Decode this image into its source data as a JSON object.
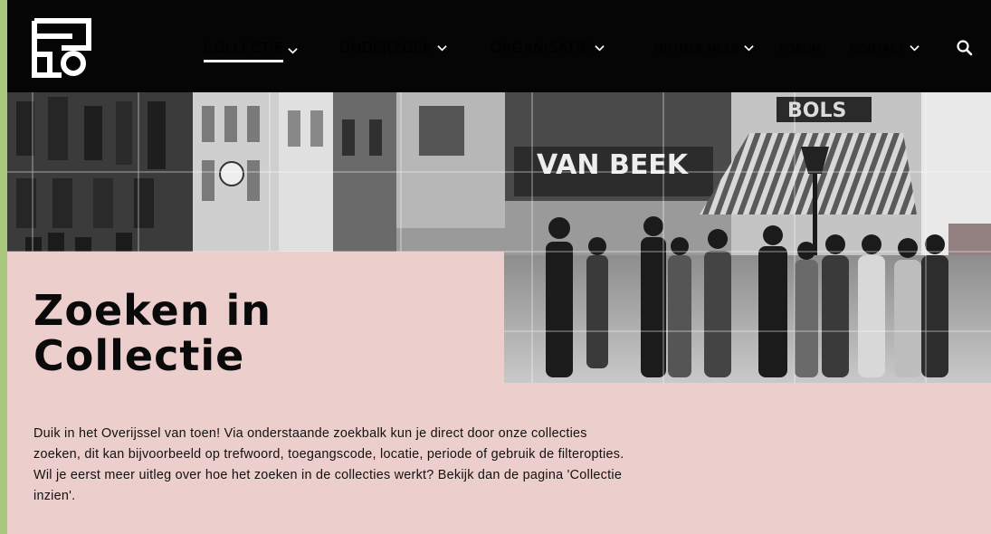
{
  "header": {
    "logo_name": "archive-logo",
    "nav_main": [
      {
        "label": "COLLECTIE",
        "active": true
      },
      {
        "label": "ONDERZOEK",
        "active": false
      },
      {
        "label": "ORGANISATIE",
        "active": false
      }
    ],
    "nav_secondary": [
      {
        "label": "ONTDEK MEER",
        "dropdown": true
      },
      {
        "label": "FORUM",
        "dropdown": false
      },
      {
        "label": "CONTACT",
        "dropdown": true
      }
    ],
    "search_icon": "search-icon"
  },
  "hero": {
    "photo_signs": [
      "VAN BEEK",
      "BOLS"
    ],
    "title_line1": "Zoeken in",
    "title_line2": "Collectie"
  },
  "intro": {
    "text": "Duik in het Overijssel van toen! Via onderstaande zoekbalk kun je direct door onze collecties zoeken, dit kan bijvoorbeeld op trefwoord, toegangscode, locatie, periode of gebruik de filteropties. Wil je eerst meer uitleg over hoe het zoeken in de collecties werkt? Bekijk dan de pagina 'Collectie inzien'."
  },
  "colors": {
    "header_bg": "#050505",
    "page_bg": "#eccfcc",
    "outer_bg": "#a9c77c",
    "text": "#111111"
  }
}
